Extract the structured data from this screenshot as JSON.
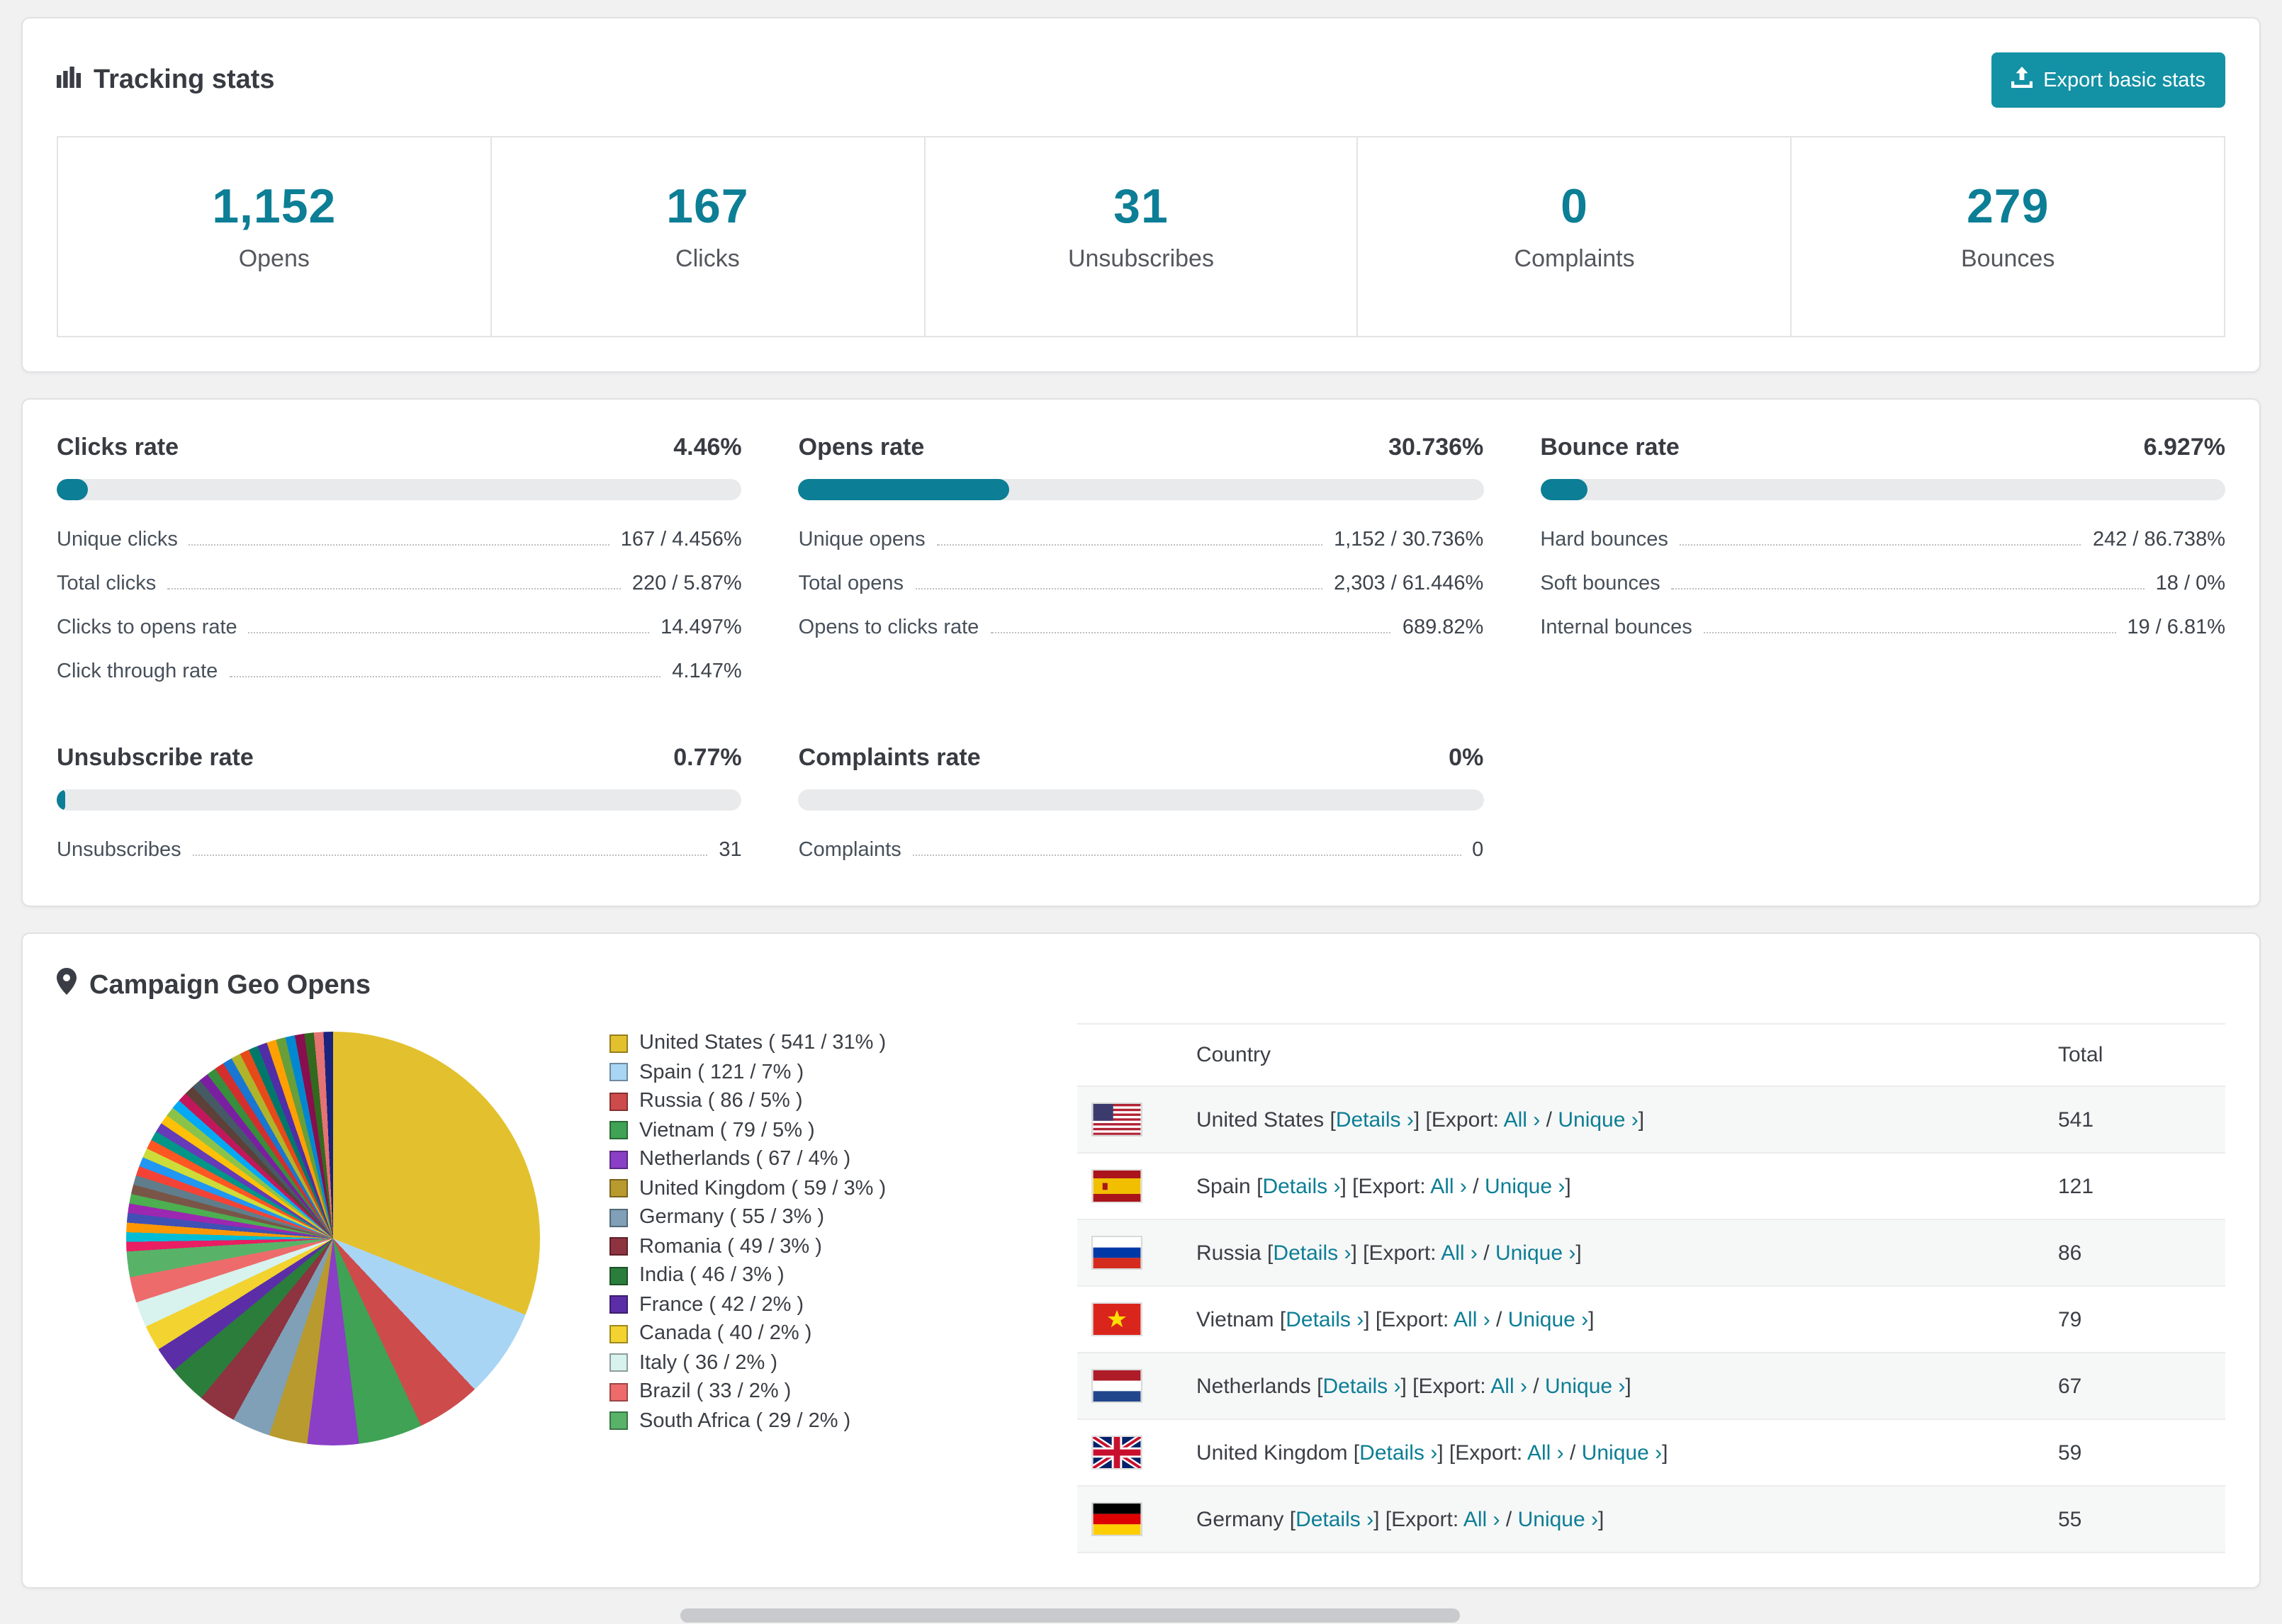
{
  "colors": {
    "accent": "#0C7E95",
    "button": "#1391A5",
    "bar_fill": "#0C7E95"
  },
  "tracking": {
    "title": "Tracking stats",
    "export_button": "Export basic stats",
    "summary": [
      {
        "value": "1,152",
        "label": "Opens"
      },
      {
        "value": "167",
        "label": "Clicks"
      },
      {
        "value": "31",
        "label": "Unsubscribes"
      },
      {
        "value": "0",
        "label": "Complaints"
      },
      {
        "value": "279",
        "label": "Bounces"
      }
    ]
  },
  "rates": [
    {
      "title": "Clicks rate",
      "value": "4.46%",
      "pct": 4.46,
      "rows": [
        {
          "label": "Unique clicks",
          "value": "167 / 4.456%"
        },
        {
          "label": "Total clicks",
          "value": "220 / 5.87%"
        },
        {
          "label": "Clicks to opens rate",
          "value": "14.497%"
        },
        {
          "label": "Click through rate",
          "value": "4.147%"
        }
      ]
    },
    {
      "title": "Opens rate",
      "value": "30.736%",
      "pct": 30.736,
      "rows": [
        {
          "label": "Unique opens",
          "value": "1,152 / 30.736%"
        },
        {
          "label": "Total opens",
          "value": "2,303 / 61.446%"
        },
        {
          "label": "Opens to clicks rate",
          "value": "689.82%"
        }
      ]
    },
    {
      "title": "Bounce rate",
      "value": "6.927%",
      "pct": 6.927,
      "rows": [
        {
          "label": "Hard bounces",
          "value": "242 / 86.738%"
        },
        {
          "label": "Soft bounces",
          "value": "18 / 0%"
        },
        {
          "label": "Internal bounces",
          "value": "19 / 6.81%"
        }
      ]
    },
    {
      "title": "Unsubscribe rate",
      "value": "0.77%",
      "pct": 0.77,
      "rows": [
        {
          "label": "Unsubscribes",
          "value": "31"
        }
      ]
    },
    {
      "title": "Complaints rate",
      "value": "0%",
      "pct": 0,
      "rows": [
        {
          "label": "Complaints",
          "value": "0"
        }
      ]
    }
  ],
  "geo": {
    "title": "Campaign Geo Opens",
    "chart_data": {
      "type": "pie",
      "title": "Campaign Geo Opens",
      "labels": [
        "United States",
        "Spain",
        "Russia",
        "Vietnam",
        "Netherlands",
        "United Kingdom",
        "Germany",
        "Romania",
        "India",
        "France",
        "Canada",
        "Italy",
        "Brazil",
        "South Africa"
      ],
      "values": [
        541,
        121,
        86,
        79,
        67,
        59,
        55,
        49,
        46,
        42,
        40,
        36,
        33,
        29
      ],
      "percents": [
        31,
        7,
        5,
        5,
        4,
        3,
        3,
        3,
        3,
        2,
        2,
        2,
        2,
        2
      ],
      "colors": [
        "#E3C12E",
        "#A9D5F5",
        "#CE4B4B",
        "#3FA254",
        "#8A3FC6",
        "#B89A2E",
        "#7FA0B6",
        "#8E3340",
        "#2B7D3B",
        "#5B2EA8",
        "#F2D32F",
        "#D8F2EE",
        "#EE6B6B",
        "#58B368"
      ],
      "others_percent": 26,
      "legend_position": "right"
    },
    "table": {
      "headers": [
        "Country",
        "Total"
      ],
      "link_labels": {
        "details": "Details ›",
        "export": "Export:",
        "all": "All ›",
        "unique": "Unique ›"
      },
      "rows": [
        {
          "code": "us",
          "country": "United States",
          "total": "541"
        },
        {
          "code": "es",
          "country": "Spain",
          "total": "121"
        },
        {
          "code": "ru",
          "country": "Russia",
          "total": "86"
        },
        {
          "code": "vn",
          "country": "Vietnam",
          "total": "79"
        },
        {
          "code": "nl",
          "country": "Netherlands",
          "total": "67"
        },
        {
          "code": "gb",
          "country": "United Kingdom",
          "total": "59"
        },
        {
          "code": "de",
          "country": "Germany",
          "total": "55"
        }
      ]
    }
  }
}
